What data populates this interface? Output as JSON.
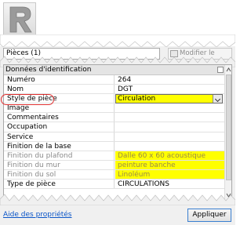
{
  "type_selector": {
    "value": "Pièces (1)"
  },
  "edit_type_button": {
    "label": "Modifier le type"
  },
  "group": {
    "title": "Données d'identification"
  },
  "properties": [
    {
      "name": "Numéro",
      "value": "264"
    },
    {
      "name": "Nom",
      "value": "DGT"
    },
    {
      "name": "Style de pièce",
      "value": "Circulation"
    },
    {
      "name": "Image",
      "value": ""
    },
    {
      "name": "Commentaires",
      "value": ""
    },
    {
      "name": "Occupation",
      "value": ""
    },
    {
      "name": "Service",
      "value": ""
    },
    {
      "name": "Finition de la base",
      "value": ""
    },
    {
      "name": "Finition du plafond",
      "value": "Dalle 60 x 60 acoustique"
    },
    {
      "name": "Finition du mur",
      "value": "peinture banche"
    },
    {
      "name": "Finition du sol",
      "value": "Linoléum"
    },
    {
      "name": "Type de pièce",
      "value": "CIRCULATIONS"
    }
  ],
  "footer": {
    "help_link": "Aide des propriétés",
    "apply_button": "Appliquer"
  },
  "colors": {
    "highlight": "#ffff00",
    "annotation": "#e03030",
    "link": "#0a55c8"
  },
  "icons": {
    "app_logo": "revit-r-icon",
    "edit_type": "edit-type-icon",
    "dropdown": "chevron-down-icon"
  }
}
